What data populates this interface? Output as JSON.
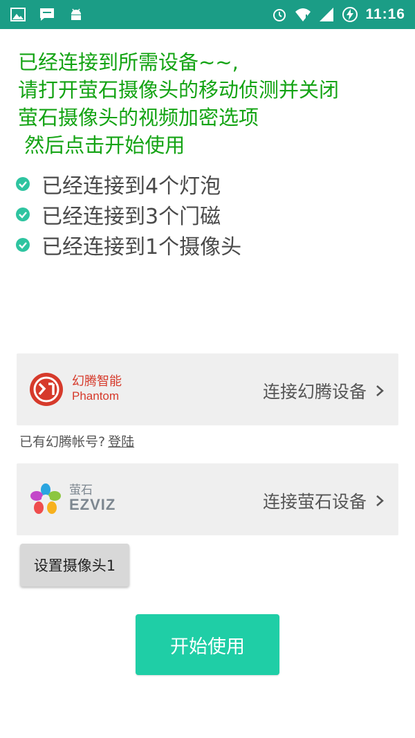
{
  "status_bar": {
    "time": "11:16",
    "left_icons": [
      "image-icon",
      "message-icon",
      "android-icon"
    ],
    "right_icons": [
      "alarm-icon",
      "wifi-icon",
      "signal-icon",
      "battery-charging-icon"
    ],
    "color": "#1b9d86"
  },
  "headline": {
    "lines": [
      "已经连接到所需设备~~,",
      "请打开萤石摄像头的移动侦测并关闭",
      "萤石摄像头的视频加密选项",
      " 然后点击开始使用"
    ],
    "color": "#13a313"
  },
  "checklist": [
    {
      "text": "已经连接到4个灯泡"
    },
    {
      "text": "已经连接到3个门磁"
    },
    {
      "text": "已经连接到1个摄像头"
    }
  ],
  "phantom_card": {
    "logo_cn": "幻腾智能",
    "logo_en": "Phantom",
    "action": "连接幻腾设备",
    "brand_color": "#d63a2b"
  },
  "login": {
    "prompt": "已有幻腾帐号?",
    "link": "登陆"
  },
  "ezviz_card": {
    "logo_cn": "萤石",
    "logo_en": "EZVIZ",
    "action": "连接萤石设备"
  },
  "setup_button": {
    "label": "设置摄像头1"
  },
  "start_button": {
    "label": "开始使用",
    "color": "#1fcea6"
  }
}
